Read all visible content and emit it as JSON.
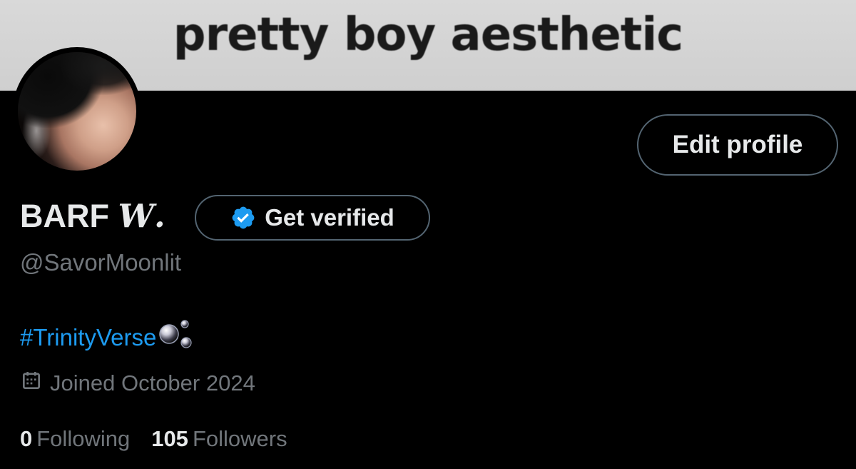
{
  "banner": {
    "text": "pretty boy aesthetic"
  },
  "profile": {
    "display_name": "BARF",
    "display_name_fancy": "𝑾.",
    "handle": "@SavorMoonlit",
    "bio_hashtag": "#TrinityVerse",
    "bio_emoji": "bubbles-icon",
    "joined": "Joined October 2024"
  },
  "buttons": {
    "edit_profile": "Edit profile",
    "get_verified": "Get verified"
  },
  "stats": {
    "following_count": "0",
    "following_label": "Following",
    "followers_count": "105",
    "followers_label": "Followers"
  },
  "colors": {
    "background": "#000000",
    "primary_text": "#e7e9ea",
    "secondary_text": "#71767b",
    "link": "#1d9bf0",
    "verified_badge": "#1d9bf0",
    "button_border": "#536471",
    "banner_bg": "#d4d4d4"
  }
}
